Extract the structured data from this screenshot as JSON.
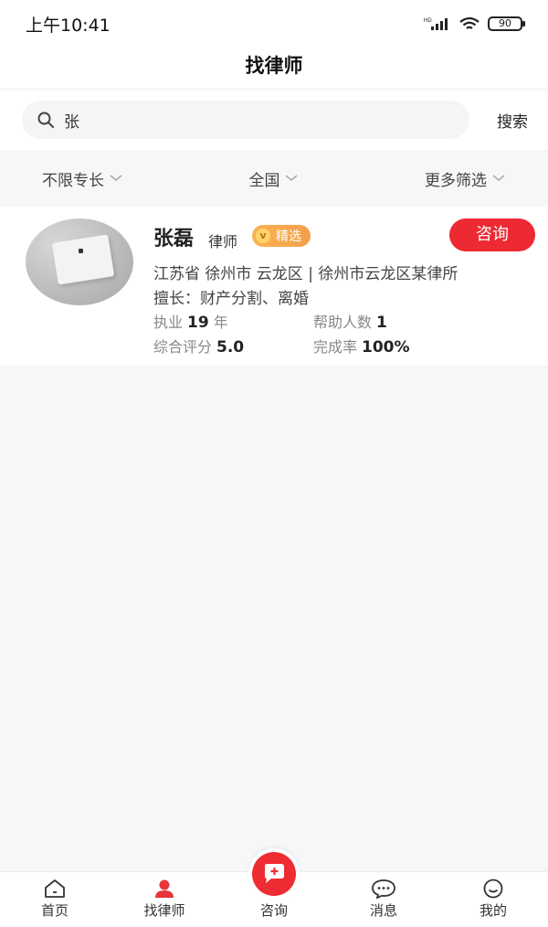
{
  "status_bar": {
    "time": "上午10:41",
    "battery": "90"
  },
  "nav": {
    "title": "找律师"
  },
  "search": {
    "value": "张",
    "button_label": "搜索"
  },
  "filters": [
    {
      "label": "不限专长"
    },
    {
      "label": "全国"
    },
    {
      "label": "更多筛选"
    }
  ],
  "lawyer": {
    "name": "张磊",
    "role": "律师",
    "badge": "精选",
    "consult_label": "咨询",
    "location": "江苏省 徐州市 云龙区 | 徐州市云龙区某律所",
    "specialty": "擅长：财产分割、离婚",
    "years_label": "执业",
    "years_value": "19",
    "years_unit": "年",
    "helped_label": "帮助人数",
    "helped_value": "1",
    "rating_label": "综合评分",
    "rating_value": "5.0",
    "completion_label": "完成率",
    "completion_value": "100%"
  },
  "tabs": [
    {
      "label": "首页",
      "icon": "home-icon"
    },
    {
      "label": "找律师",
      "icon": "lawyer-icon"
    },
    {
      "label": "咨询",
      "icon": "consult-plus-icon"
    },
    {
      "label": "消息",
      "icon": "message-icon"
    },
    {
      "label": "我的",
      "icon": "profile-icon"
    }
  ],
  "colors": {
    "accent_red": "#ed2a33",
    "badge_orange": "#f2a04a"
  }
}
